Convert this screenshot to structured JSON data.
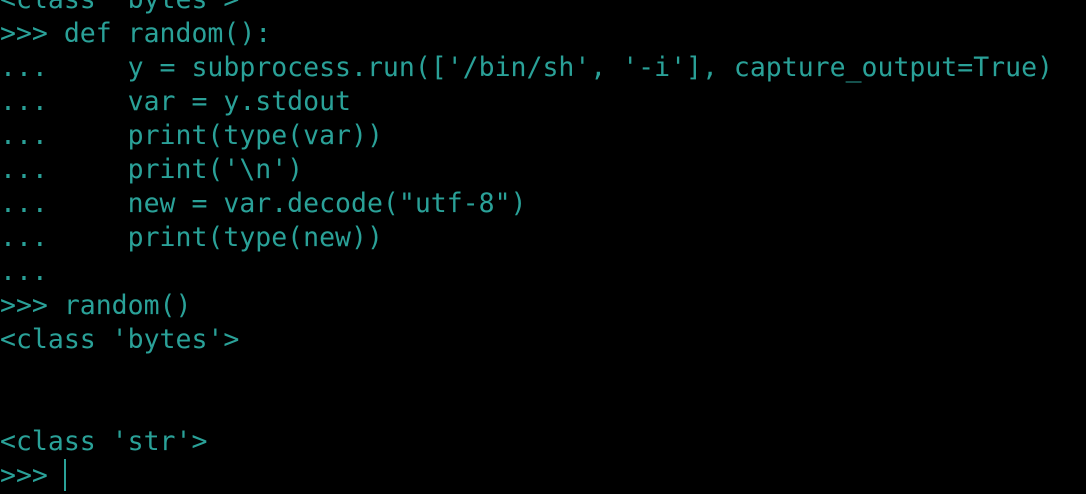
{
  "terminal": {
    "lines": [
      "<class 'bytes'>",
      ">>> def random():",
      "...     y = subprocess.run(['/bin/sh', '-i'], capture_output=True)",
      "...     var = y.stdout",
      "...     print(type(var))",
      "...     print('\\n')",
      "...     new = var.decode(\"utf-8\")",
      "...     print(type(new))",
      "...",
      ">>> random()",
      "<class 'bytes'>",
      "",
      "",
      "<class 'str'>",
      ">>> "
    ],
    "text_color": "#2aa198",
    "background_color": "#000000"
  }
}
